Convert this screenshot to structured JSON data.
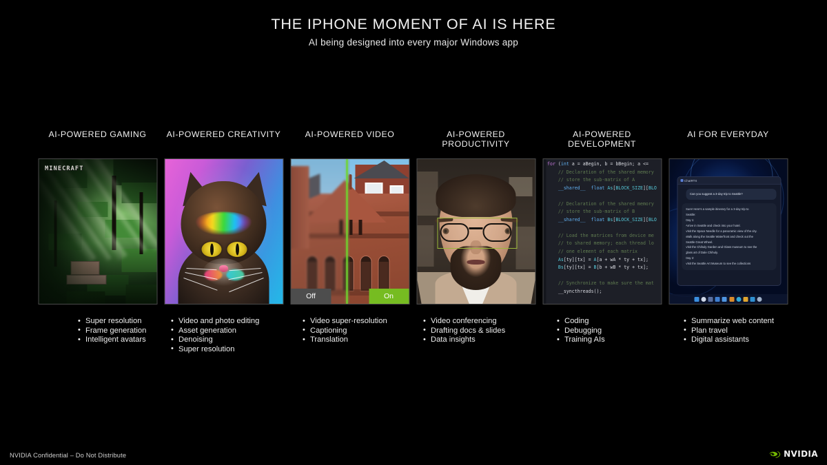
{
  "slide": {
    "title": "THE IPHONE MOMENT OF AI IS HERE",
    "subtitle": "AI being designed into every major Windows app",
    "footer_note": "NVIDIA Confidential – Do Not Distribute",
    "background_color": "#000000",
    "accent_color": "#76b900"
  },
  "brand": {
    "name": "NVIDIA",
    "logo_icon": "nvidia-eye-icon",
    "logo_color": "#76b900"
  },
  "columns": [
    {
      "id": "gaming",
      "heading": "AI-POWERED GAMING",
      "image_name": "minecraft-rtx-screenshot",
      "image_caption": "MINECRAFT",
      "bullets": [
        "Super resolution",
        "Frame generation",
        "Intelligent avatars"
      ]
    },
    {
      "id": "creativity",
      "heading": "AI-POWERED CREATIVITY",
      "image_name": "ai-generated-colorful-cat",
      "bullets": [
        "Video and photo editing",
        "Asset generation",
        "Denoising",
        "Super resolution"
      ]
    },
    {
      "id": "video",
      "heading": "AI-POWERED VIDEO",
      "image_name": "video-super-resolution-comparison",
      "toggle_off_label": "Off",
      "toggle_on_label": "On",
      "bullets": [
        "Video super-resolution",
        "Captioning",
        "Translation"
      ]
    },
    {
      "id": "productivity",
      "heading": "AI-POWERED PRODUCTIVITY",
      "heading_lines": [
        "AI-POWERED",
        "PRODUCTIVITY"
      ],
      "image_name": "video-conferencing-eye-contact",
      "bullets": [
        "Video conferencing",
        "Drafting docs & slides",
        "Data insights"
      ]
    },
    {
      "id": "development",
      "heading": "AI-POWERED DEVELOPMENT",
      "heading_lines": [
        "AI-POWERED",
        "DEVELOPMENT"
      ],
      "image_name": "cuda-code-editor",
      "bullets": [
        "Coding",
        "Debugging",
        "Training AIs"
      ]
    },
    {
      "id": "everyday",
      "heading": "AI FOR EVERYDAY",
      "image_name": "windows-chat-assistant",
      "bullets": [
        "Summarize web content",
        "Plan travel",
        "Digital assistants"
      ]
    }
  ],
  "code_panel": {
    "language": "cuda-c",
    "lines": [
      "for (int a = aBegin, b = bBegin; a <=",
      "    // Declaration of the shared memory",
      "    // store the sub-matrix of A",
      "    __shared__ float As[BLOCK_SIZE][BLO",
      "",
      "    // Declaration of the shared memory",
      "    // store the sub-matrix of B",
      "    __shared__ float Bs[BLOCK_SIZE][BLO",
      "",
      "    // Load the matrices from device me",
      "    // to shared memory; each thread lo",
      "    // one element of each matrix",
      "    As[ty][tx] = A[a + wA * ty + tx];",
      "    Bs[ty][tx] = B[b + wB * ty + tx];",
      "",
      "    // Synchronize to make sure the mat",
      "    __syncthreads();"
    ]
  },
  "chat_panel": {
    "window_title": "ChatRTX",
    "user_message": "Can you suggest a 3-day trip to Seattle?",
    "assistant_lines": [
      "Sure! Here's a sample itinerary for a 3-day trip to",
      "Seattle:",
      "Day 1:",
      "Arrive in Seattle and check into your hotel.",
      "Visit the Space Needle for a panoramic view of the city.",
      "Walk along the Seattle Waterfront and check out the",
      "Seattle Great Wheel.",
      "Visit the Chihuly Garden and Glass museum to see the",
      "glass art of Dale Chihuly.",
      "Day 2:",
      "Visit the Seattle Art Museum to see the collections"
    ],
    "taskbar_icon_colors": [
      "#3b8fe0",
      "#cfd8e8",
      "#5a6f9e",
      "#3f7fd0",
      "#4f95e0",
      "#d98a2b",
      "#2fa8d8",
      "#e0a52f",
      "#2f8fd0",
      "#9fb0c8"
    ]
  }
}
